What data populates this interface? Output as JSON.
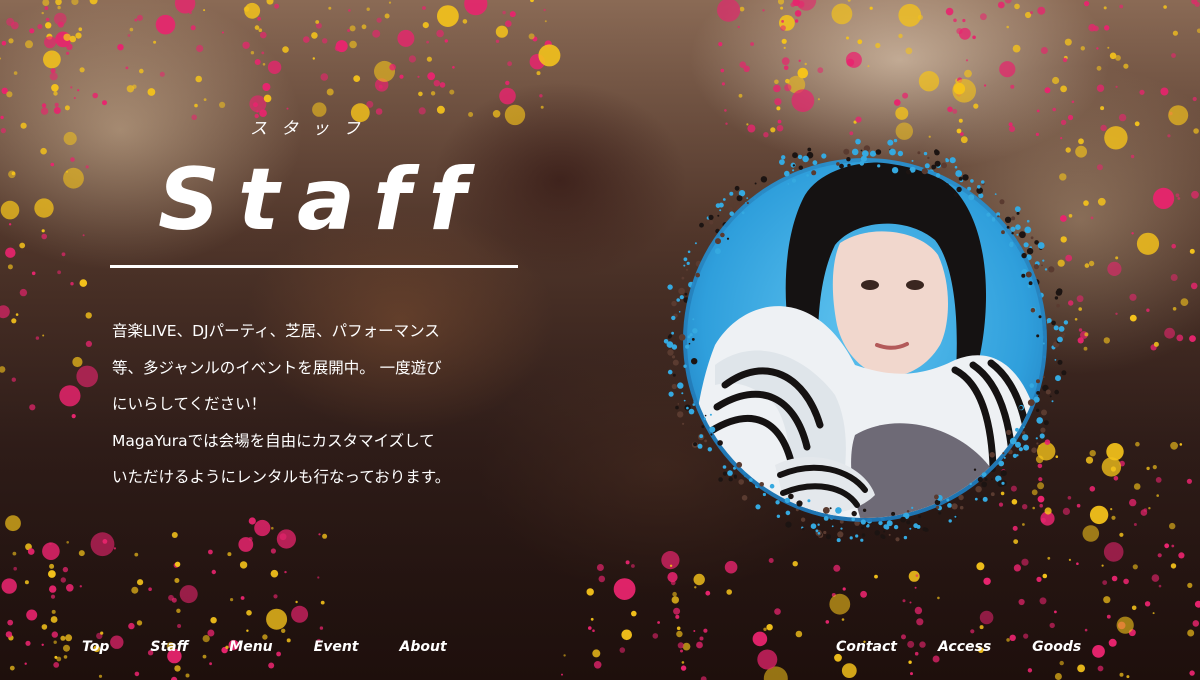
{
  "heading": {
    "kana": "スタッフ",
    "title": "Staff"
  },
  "description": {
    "lines": [
      "音楽LIVE、DJパーティ、芝居、パフォーマンス",
      "等、多ジャンルのイベントを展開中。 一度遊び",
      "にいらしてください！",
      "MagaYuraでは会場を自由にカスタマイズして",
      "いただけるようにレンタルも行なっております。"
    ]
  },
  "nav": {
    "left": [
      "Top",
      "Staff",
      "Menu",
      "Event",
      "About"
    ],
    "right": [
      "Contact",
      "Access",
      "Goods"
    ]
  },
  "colors": {
    "splatter_pink": "#e8246e",
    "splatter_yellow": "#f4c21b",
    "splatter_blue": "#35a9e0",
    "text": "#ffffff"
  }
}
